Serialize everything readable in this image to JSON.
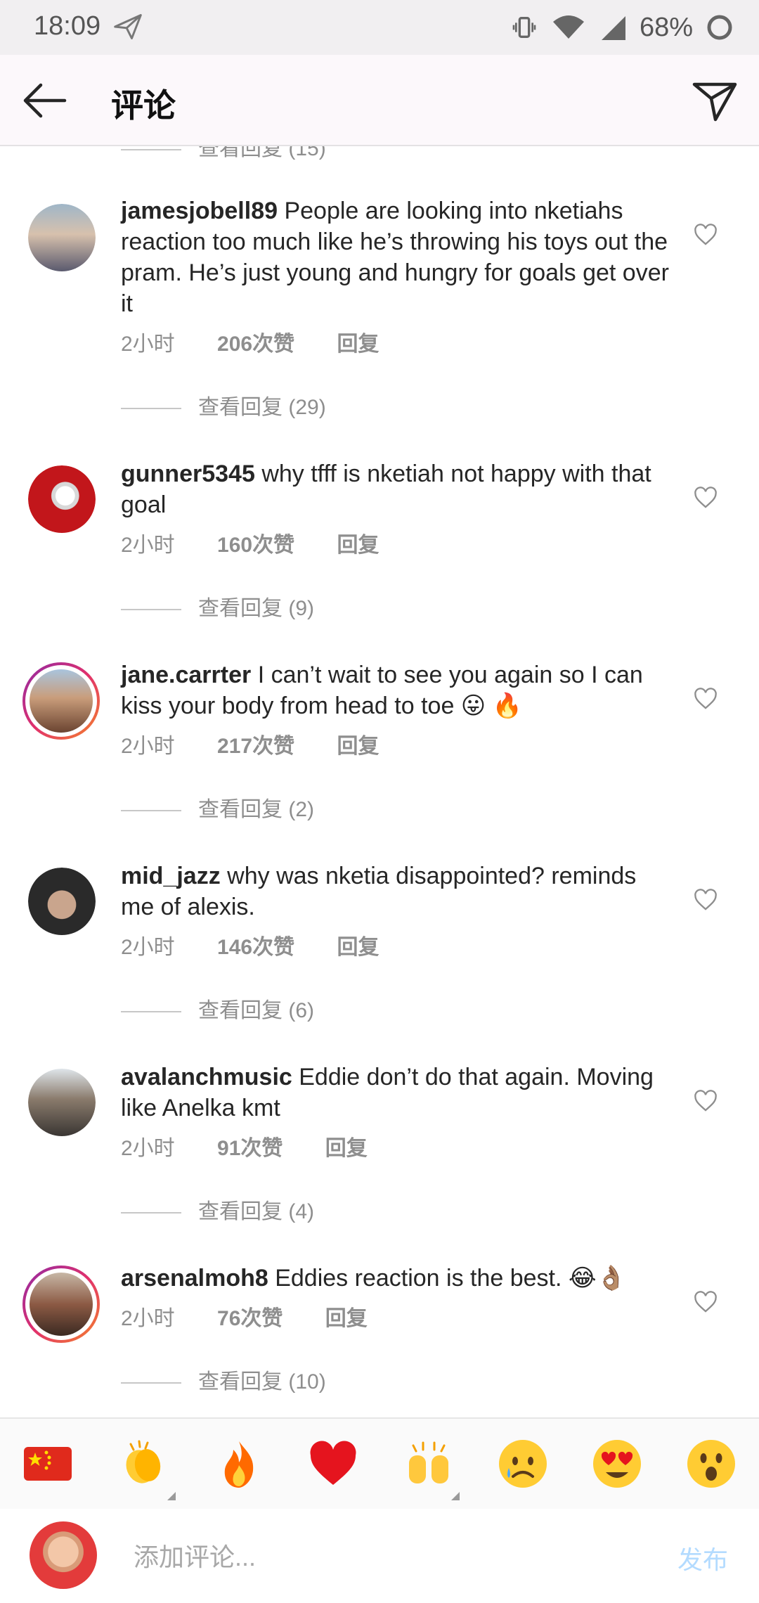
{
  "status_bar": {
    "time": "18:09",
    "battery": "68%"
  },
  "header": {
    "title": "评论"
  },
  "partial_view_replies": "查看回复 (15)",
  "comments": [
    {
      "username": "jamesjobell89",
      "text": "People are looking into nketiahs reaction too much like he’s throwing his toys out the pram. He’s just young and hungry for goals get over it",
      "time": "2小时",
      "likes": "206次赞",
      "reply": "回复",
      "view_replies": "查看回复 (29)"
    },
    {
      "username": "gunner5345",
      "text": "why tfff is nketiah not happy with that goal",
      "time": "2小时",
      "likes": "160次赞",
      "reply": "回复",
      "view_replies": "查看回复 (9)"
    },
    {
      "username": "jane.carrter",
      "text": "I can’t wait to see you again so I can kiss your body from head to toe 😛 🔥",
      "time": "2小时",
      "likes": "217次赞",
      "reply": "回复",
      "view_replies": "查看回复 (2)"
    },
    {
      "username": "mid_jazz",
      "text": "why was nketia disappointed? reminds me of alexis.",
      "time": "2小时",
      "likes": "146次赞",
      "reply": "回复",
      "view_replies": "查看回复 (6)"
    },
    {
      "username": "avalanchmusic",
      "text": "Eddie don’t do that again. Moving like Anelka kmt",
      "time": "2小时",
      "likes": "91次赞",
      "reply": "回复",
      "view_replies": "查看回复 (4)"
    },
    {
      "username": "arsenalmoh8",
      "text": "Eddies reaction is the best. 😂👌🏽",
      "time": "2小时",
      "likes": "76次赞",
      "reply": "回复",
      "view_replies": "查看回复 (10)"
    }
  ],
  "emoji_bar": [
    "🇨🇳",
    "👏",
    "🔥",
    "❤️",
    "🙌",
    "😥",
    "😍",
    "😮"
  ],
  "comment_input": {
    "placeholder": "添加评论...",
    "post_label": "发布"
  },
  "colors": {
    "post_disabled": "#b3dbff",
    "story_ring": "#e1306c",
    "meta_gray": "#8e8e8e"
  }
}
